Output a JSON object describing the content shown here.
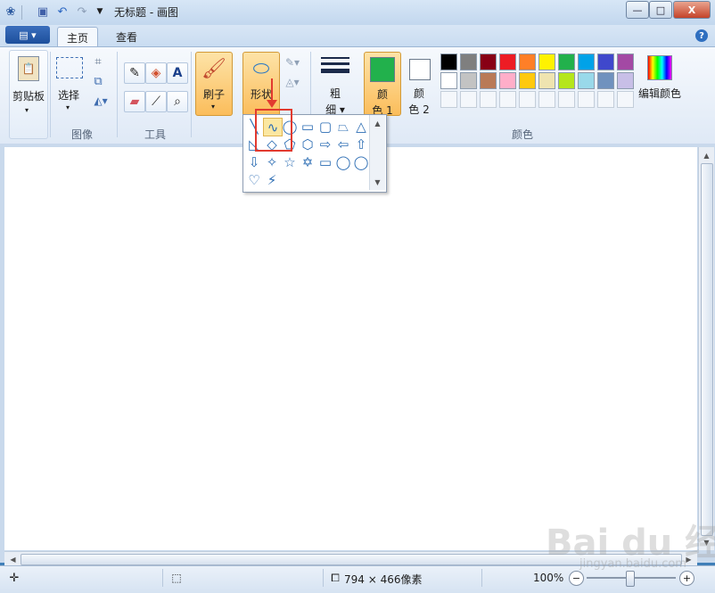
{
  "window": {
    "title": "无标题 - 画图",
    "controls": {
      "minimize": "—",
      "maximize": "□",
      "close": "X"
    }
  },
  "quick_access": {
    "icons": [
      "paint-app-icon",
      "save-icon",
      "undo-icon",
      "redo-icon",
      "dropdown-icon"
    ]
  },
  "tabs": [
    {
      "label": "主页",
      "active": true
    },
    {
      "label": "查看",
      "active": false
    }
  ],
  "help": "?",
  "ribbon": {
    "clipboard": {
      "label": "剪贴板"
    },
    "image": {
      "select_label": "选择",
      "group_label": "图像"
    },
    "tools": {
      "group_label": "工具"
    },
    "brushes": {
      "label": "刷子"
    },
    "shapes": {
      "label": "形状"
    },
    "size": {
      "label_line1": "粗",
      "label_line2": "细"
    },
    "color1": {
      "line1": "颜",
      "line2": "色 1",
      "value": "#22b14c"
    },
    "color2": {
      "line1": "颜",
      "line2": "色 2",
      "value": "#ffffff"
    },
    "colors_group_label": "颜色",
    "edit_colors": {
      "label": "编辑颜色"
    },
    "palette_row1": [
      "#000000",
      "#7f7f7f",
      "#880015",
      "#ed1c24",
      "#ff7f27",
      "#fff200",
      "#22b14c",
      "#00a2e8",
      "#3f48cc",
      "#a349a4"
    ],
    "palette_row2": [
      "#ffffff",
      "#c3c3c3",
      "#b97a57",
      "#ffaec9",
      "#ffc90e",
      "#efe4b0",
      "#b5e61d",
      "#99d9ea",
      "#7092be",
      "#c8bfe7"
    ]
  },
  "shapes_menu": {
    "row1": [
      "╲",
      "∿",
      "◯",
      "▭",
      "▢",
      "⏢",
      "△"
    ],
    "row2": [
      "◺",
      "◇",
      "⬠",
      "⬡",
      "⇨",
      "⇦",
      "⇧"
    ],
    "row3": [
      "⇩",
      "✧",
      "☆",
      "✡",
      "▭",
      "◯",
      "◯"
    ],
    "row4": [
      "♡",
      "⚡"
    ],
    "selected": "曲线"
  },
  "status": {
    "canvas_size": "794 × 466像素",
    "zoom": "100%",
    "zoom_out": "−",
    "zoom_in": "+"
  },
  "watermark": {
    "text": "Bai du 经验",
    "url": "jingyan.baidu.com"
  }
}
